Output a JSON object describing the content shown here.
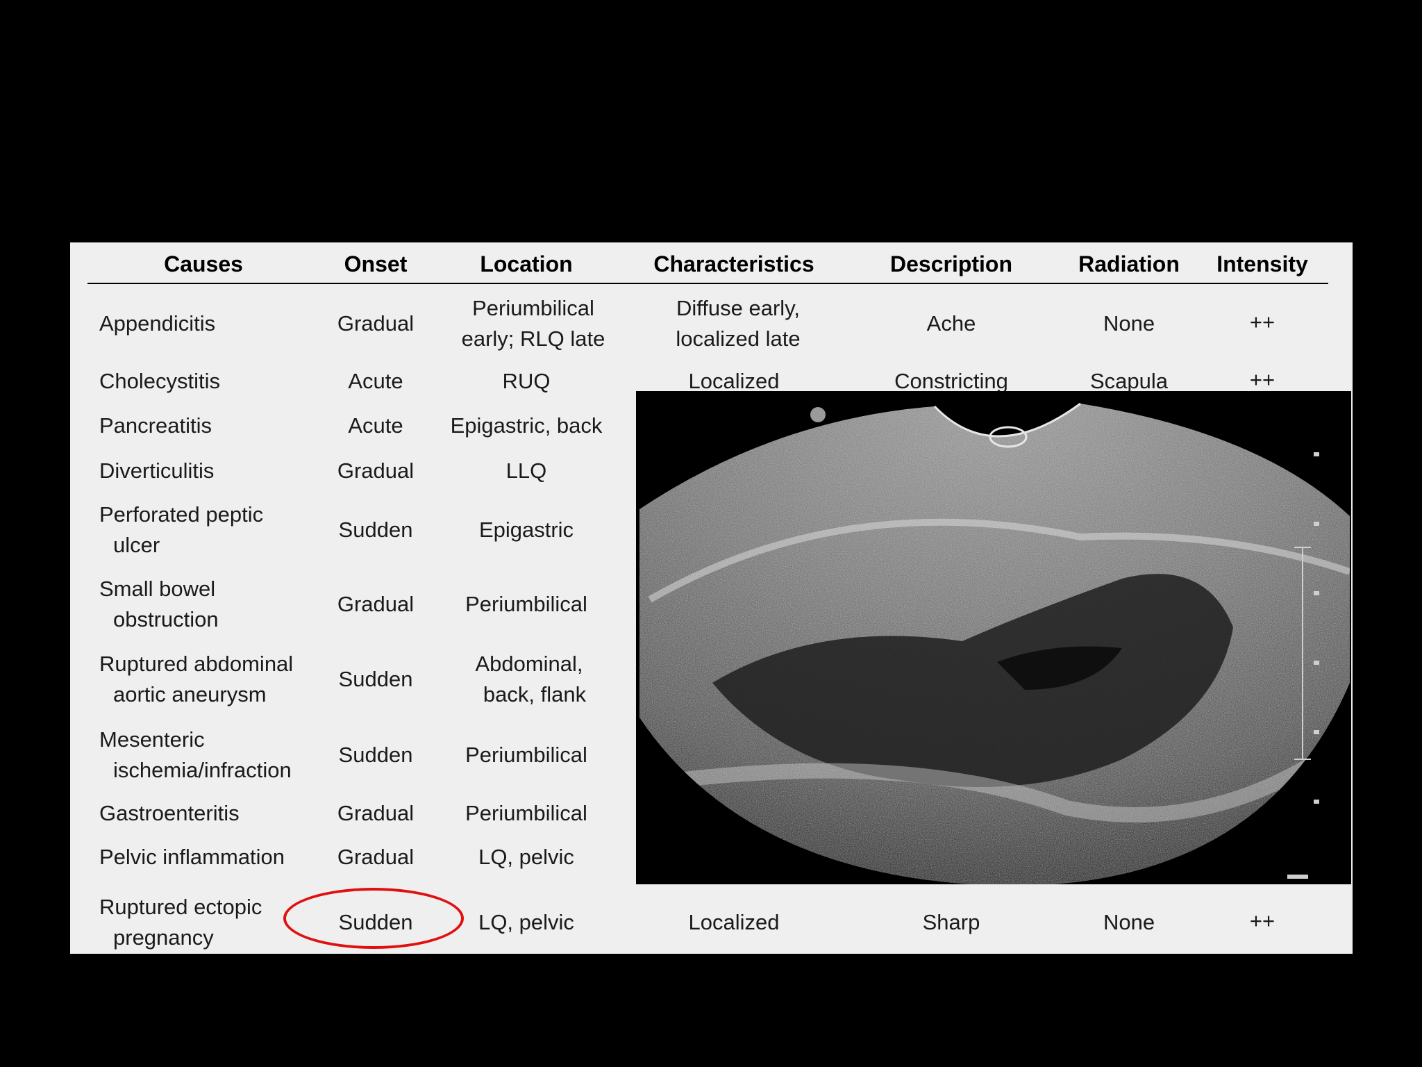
{
  "table": {
    "headers": [
      "Causes",
      "Onset",
      "Location",
      "Characteristics",
      "Description",
      "Radiation",
      "Intensity"
    ],
    "rows": [
      {
        "cause": [
          "Appendicitis"
        ],
        "onset": "Gradual",
        "location": [
          "Periumbilical",
          "early; RLQ late"
        ],
        "characteristics": [
          "Diffuse early,",
          "localized late"
        ],
        "description": "Ache",
        "radiation": "None",
        "intensity": "++"
      },
      {
        "cause": [
          "Cholecystitis"
        ],
        "onset": "Acute",
        "location": [
          "RUQ"
        ],
        "characteristics": [
          "Localized"
        ],
        "description": "Constricting",
        "radiation": "Scapula",
        "intensity": "++"
      },
      {
        "cause": [
          "Pancreatitis"
        ],
        "onset": "Acute",
        "location": [
          "Epigastric, back"
        ]
      },
      {
        "cause": [
          "Diverticulitis"
        ],
        "onset": "Gradual",
        "location": [
          "LLQ"
        ]
      },
      {
        "cause": [
          "Perforated peptic",
          "ulcer"
        ],
        "onset": "Sudden",
        "location": [
          "Epigastric"
        ]
      },
      {
        "cause": [
          "Small bowel",
          "obstruction"
        ],
        "onset": "Gradual",
        "location": [
          "Periumbilical"
        ]
      },
      {
        "cause": [
          "Ruptured abdominal",
          "aortic aneurysm"
        ],
        "onset": "Sudden",
        "location": [
          "Abdominal,",
          "back, flank"
        ]
      },
      {
        "cause": [
          "Mesenteric",
          "ischemia/infraction"
        ],
        "onset": "Sudden",
        "location": [
          "Periumbilical"
        ]
      },
      {
        "cause": [
          "Gastroenteritis"
        ],
        "onset": "Gradual",
        "location": [
          "Periumbilical"
        ]
      },
      {
        "cause": [
          "Pelvic inflammation"
        ],
        "onset": "Gradual",
        "location": [
          "LQ, pelvic"
        ]
      },
      {
        "cause": [
          "Ruptured ectopic",
          "pregnancy"
        ],
        "onset": "Sudden",
        "location": [
          "LQ, pelvic"
        ],
        "characteristics": [
          "Localized"
        ],
        "description": "Sharp",
        "radiation": "None",
        "intensity": "++"
      }
    ]
  },
  "highlight": {
    "color": "#e01010"
  }
}
